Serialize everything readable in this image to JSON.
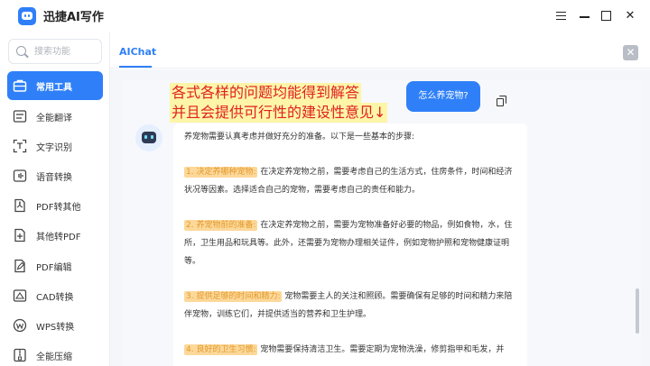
{
  "app": {
    "title": "迅捷AI写作"
  },
  "window_controls": {
    "min": "–",
    "close": "✕"
  },
  "sidebar": {
    "search_placeholder": "搜索功能",
    "items": [
      {
        "label": "常用工具",
        "icon": "toolbox-icon",
        "active": true
      },
      {
        "label": "全能翻译",
        "icon": "translate-icon"
      },
      {
        "label": "文字识别",
        "icon": "text-recognition-icon"
      },
      {
        "label": "语音转换",
        "icon": "voice-icon"
      },
      {
        "label": "PDF转其他",
        "icon": "pdf-icon"
      },
      {
        "label": "其他转PDF",
        "icon": "to-pdf-icon"
      },
      {
        "label": "PDF编辑",
        "icon": "pdf-edit-icon"
      },
      {
        "label": "CAD转换",
        "icon": "cad-icon"
      },
      {
        "label": "WPS转换",
        "icon": "wps-icon"
      },
      {
        "label": "全能压缩",
        "icon": "compress-icon"
      }
    ]
  },
  "tabbar": {
    "tab_label": "AIChat",
    "close": "✕"
  },
  "annotation": {
    "line1": "各式各样的问题均能得到解答",
    "line2": "并且会提供可行性的建设性意见↓"
  },
  "chat": {
    "user_message": "怎么养宠物?",
    "answer": {
      "intro": "养宠物需要认真考虑并做好充分的准备。以下是一些基本的步骤:",
      "sections": [
        {
          "heading": "1. 决定养哪种宠物:",
          "text": "在决定养宠物之前，需要考虑自己的生活方式，住房条件，时间和经济状况等因素。选择适合自己的宠物，需要考虑自己的责任和能力。"
        },
        {
          "heading": "2. 养宠物前的准备:",
          "text": "在决定养宠物之前，需要为宠物准备好必要的物品，例如食物，水，住所，卫生用品和玩具等。此外，还需要为宠物办理相关证件，例如宠物护照和宠物健康证明等。"
        },
        {
          "heading": "3. 提供足够的时间和精力:",
          "text": "宠物需要主人的关注和照顾。需要确保有足够的时间和精力来陪伴宠物，训练它们，并提供适当的营养和卫生护理。"
        },
        {
          "heading": "4. 良好的卫生习惯:",
          "text": "宠物需要保持清洁卫生。需要定期为宠物洗澡，修剪指甲和毛发，并"
        }
      ]
    }
  }
}
